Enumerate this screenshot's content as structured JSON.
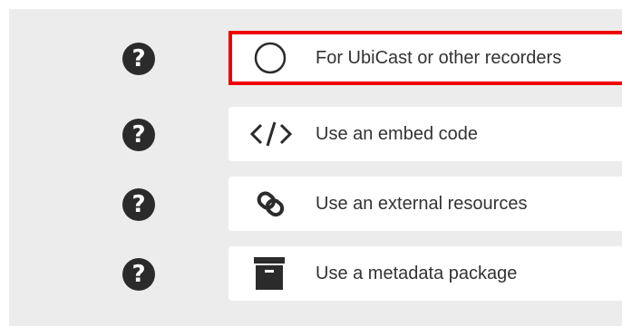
{
  "options": [
    {
      "label": "For UbiCast or other recorders",
      "icon": "circle-icon",
      "selected": true,
      "help_glyph": "?"
    },
    {
      "label": "Use an embed code",
      "icon": "code-icon",
      "selected": false,
      "help_glyph": "?"
    },
    {
      "label": "Use an external resources",
      "icon": "link-icon",
      "selected": false,
      "help_glyph": "?"
    },
    {
      "label": "Use a metadata package",
      "icon": "archive-icon",
      "selected": false,
      "help_glyph": "?"
    }
  ],
  "colors": {
    "panel_bg": "#ececec",
    "selected_border": "#ef0000",
    "help_icon": "#2b2b2b"
  }
}
